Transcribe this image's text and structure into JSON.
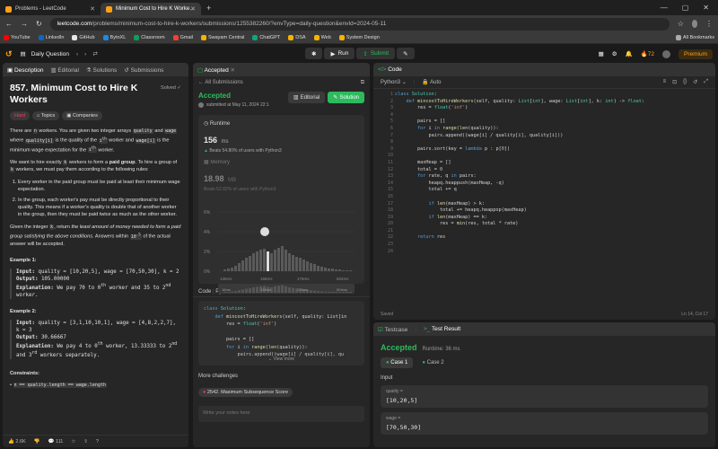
{
  "browser": {
    "tabs": [
      {
        "label": "Problems - LeetCode"
      },
      {
        "label": "Minimum Cost to Hire K Worke…"
      }
    ],
    "url_host": "leetcode.com",
    "url_path": "/problems/minimum-cost-to-hire-k-workers/submissions/1255382260/?envType=daily-question&envId=2024-05-11",
    "bookmarks": [
      {
        "label": "YouTube",
        "color": "#ff0000"
      },
      {
        "label": "LinkedIn",
        "color": "#0a66c2"
      },
      {
        "label": "GitHub",
        "color": "#e6e6e6"
      },
      {
        "label": "BytoXL",
        "color": "#1e88e5"
      },
      {
        "label": "Classroom",
        "color": "#0f9d58"
      },
      {
        "label": "Gmail",
        "color": "#ea4335"
      },
      {
        "label": "Swayam Central",
        "color": "#f4b400"
      },
      {
        "label": "ChatGPT",
        "color": "#10a37f"
      },
      {
        "label": "DSA",
        "color": "#f4b400"
      },
      {
        "label": "Web",
        "color": "#f4b400"
      },
      {
        "label": "System Design",
        "color": "#f4b400"
      }
    ],
    "all_bookmarks": "All Bookmarks"
  },
  "navbar": {
    "daily_question": "Daily Question",
    "run": "Run",
    "submit": "Submit",
    "streak": "72",
    "premium": "Premium"
  },
  "left": {
    "tabs": [
      "Description",
      "Editorial",
      "Solutions",
      "Submissions"
    ],
    "title": "857. Minimum Cost to Hire K Workers",
    "solved": "Solved",
    "difficulty": "Hard",
    "topics": "Topics",
    "companies": "Companies",
    "p1a": "There are",
    "p1b": "workers. You are given two integer arrays",
    "p1c": "and",
    "p1d": "where",
    "p1e": "is the quality of the",
    "p1f": "worker and",
    "p1g": "is the minimum wage expectation for the",
    "p1h": "worker.",
    "c_n": "n",
    "c_quality": "quality",
    "c_wage": "wage",
    "c_qi": "quality[i]",
    "c_wi": "wage[i]",
    "ith": "i",
    "th": "th",
    "p2a": "We want to hire exactly",
    "p2b": "workers to form a",
    "p2c": "paid group",
    "p2d": ". To hire a group of",
    "p2e": "workers, we must pay them according to the following rules:",
    "c_k": "k",
    "rule1": "Every worker in the paid group must be paid at least their minimum wage expectation.",
    "rule2": "In the group, each worker's pay must be directly proportional to their quality. This means if a worker's quality is double that of another worker in the group, then they must be paid twice as much as the other worker.",
    "p3a": "Given the integer",
    "p3b": ", return",
    "p3c": "the least amount of money needed to form a paid group satisfying the above conditions",
    "p3d": ". Answers within",
    "p3e": "of the actual answer will be accepted.",
    "c_tol": "10",
    "c_tol_exp": "-5",
    "ex1_head": "Example 1:",
    "ex1_input": "quality = [10,20,5], wage = [70,50,30], k = 2",
    "ex1_output": "105.00000",
    "ex1_expl": "We pay 70 to 0",
    "ex1_expl2": "worker and 35 to 2",
    "ex1_expl3": "worker.",
    "ex2_head": "Example 2:",
    "ex2_input": "quality = [3,1,10,10,1], wage = [4,8,2,2,7], k = 3",
    "ex2_output": "30.66667",
    "ex2_expl": "We pay 4 to 0",
    "ex2_expl2": "worker, 13.33333 to 2",
    "ex2_expl3": "and 3",
    "ex2_expl4": "workers separately.",
    "lbl_input": "Input:",
    "lbl_output": "Output:",
    "lbl_expl": "Explanation:",
    "constraints_head": "Constraints:",
    "constraint1": "n == quality.length == wage.length",
    "likes": "2.6K",
    "comments": "111"
  },
  "mid": {
    "tab": "Accepted",
    "back": "All Submissions",
    "status": "Accepted",
    "submitted": "submitted at May 11, 2024 22:1",
    "editorial_btn": "Editorial",
    "solution_btn": "Solution",
    "runtime_label": "Runtime",
    "runtime_value": "156",
    "runtime_unit": "ms",
    "runtime_beats": "Beats 54.80% of users with Python3",
    "memory_label": "Memory",
    "memory_value": "18.98",
    "memory_unit": "MB",
    "memory_beats": "Beats 52.82% of users with Python3",
    "y_ticks": [
      "6%",
      "4%",
      "2%",
      "0%"
    ],
    "x_ticks": [
      "136ms",
      "156ms",
      "176ms",
      "604ms"
    ],
    "x_ticks2": [
      "16ms",
      "156ms",
      "176ms",
      "604ms"
    ],
    "code_label": "Code",
    "code_lang": "Python3",
    "view_more": "View more",
    "more_challenges": "More challenges",
    "challenge1": "2542. Maximum Subsequence Score",
    "notes_placeholder": "Write your notes here"
  },
  "editor": {
    "tab": "Code",
    "lang": "Python3",
    "auto": "Auto",
    "saved": "Saved",
    "cursor": "Ln 14, Col 17"
  },
  "bottom": {
    "tabs": [
      "Testcase",
      "Test Result"
    ],
    "status": "Accepted",
    "runtime": "Runtime: 36 ms",
    "cases": [
      "Case 1",
      "Case 2"
    ],
    "input_label": "Input",
    "quality_label": "quality =",
    "quality_value": "[10,20,5]",
    "wage_label": "wage =",
    "wage_value": "[70,50,30]"
  }
}
